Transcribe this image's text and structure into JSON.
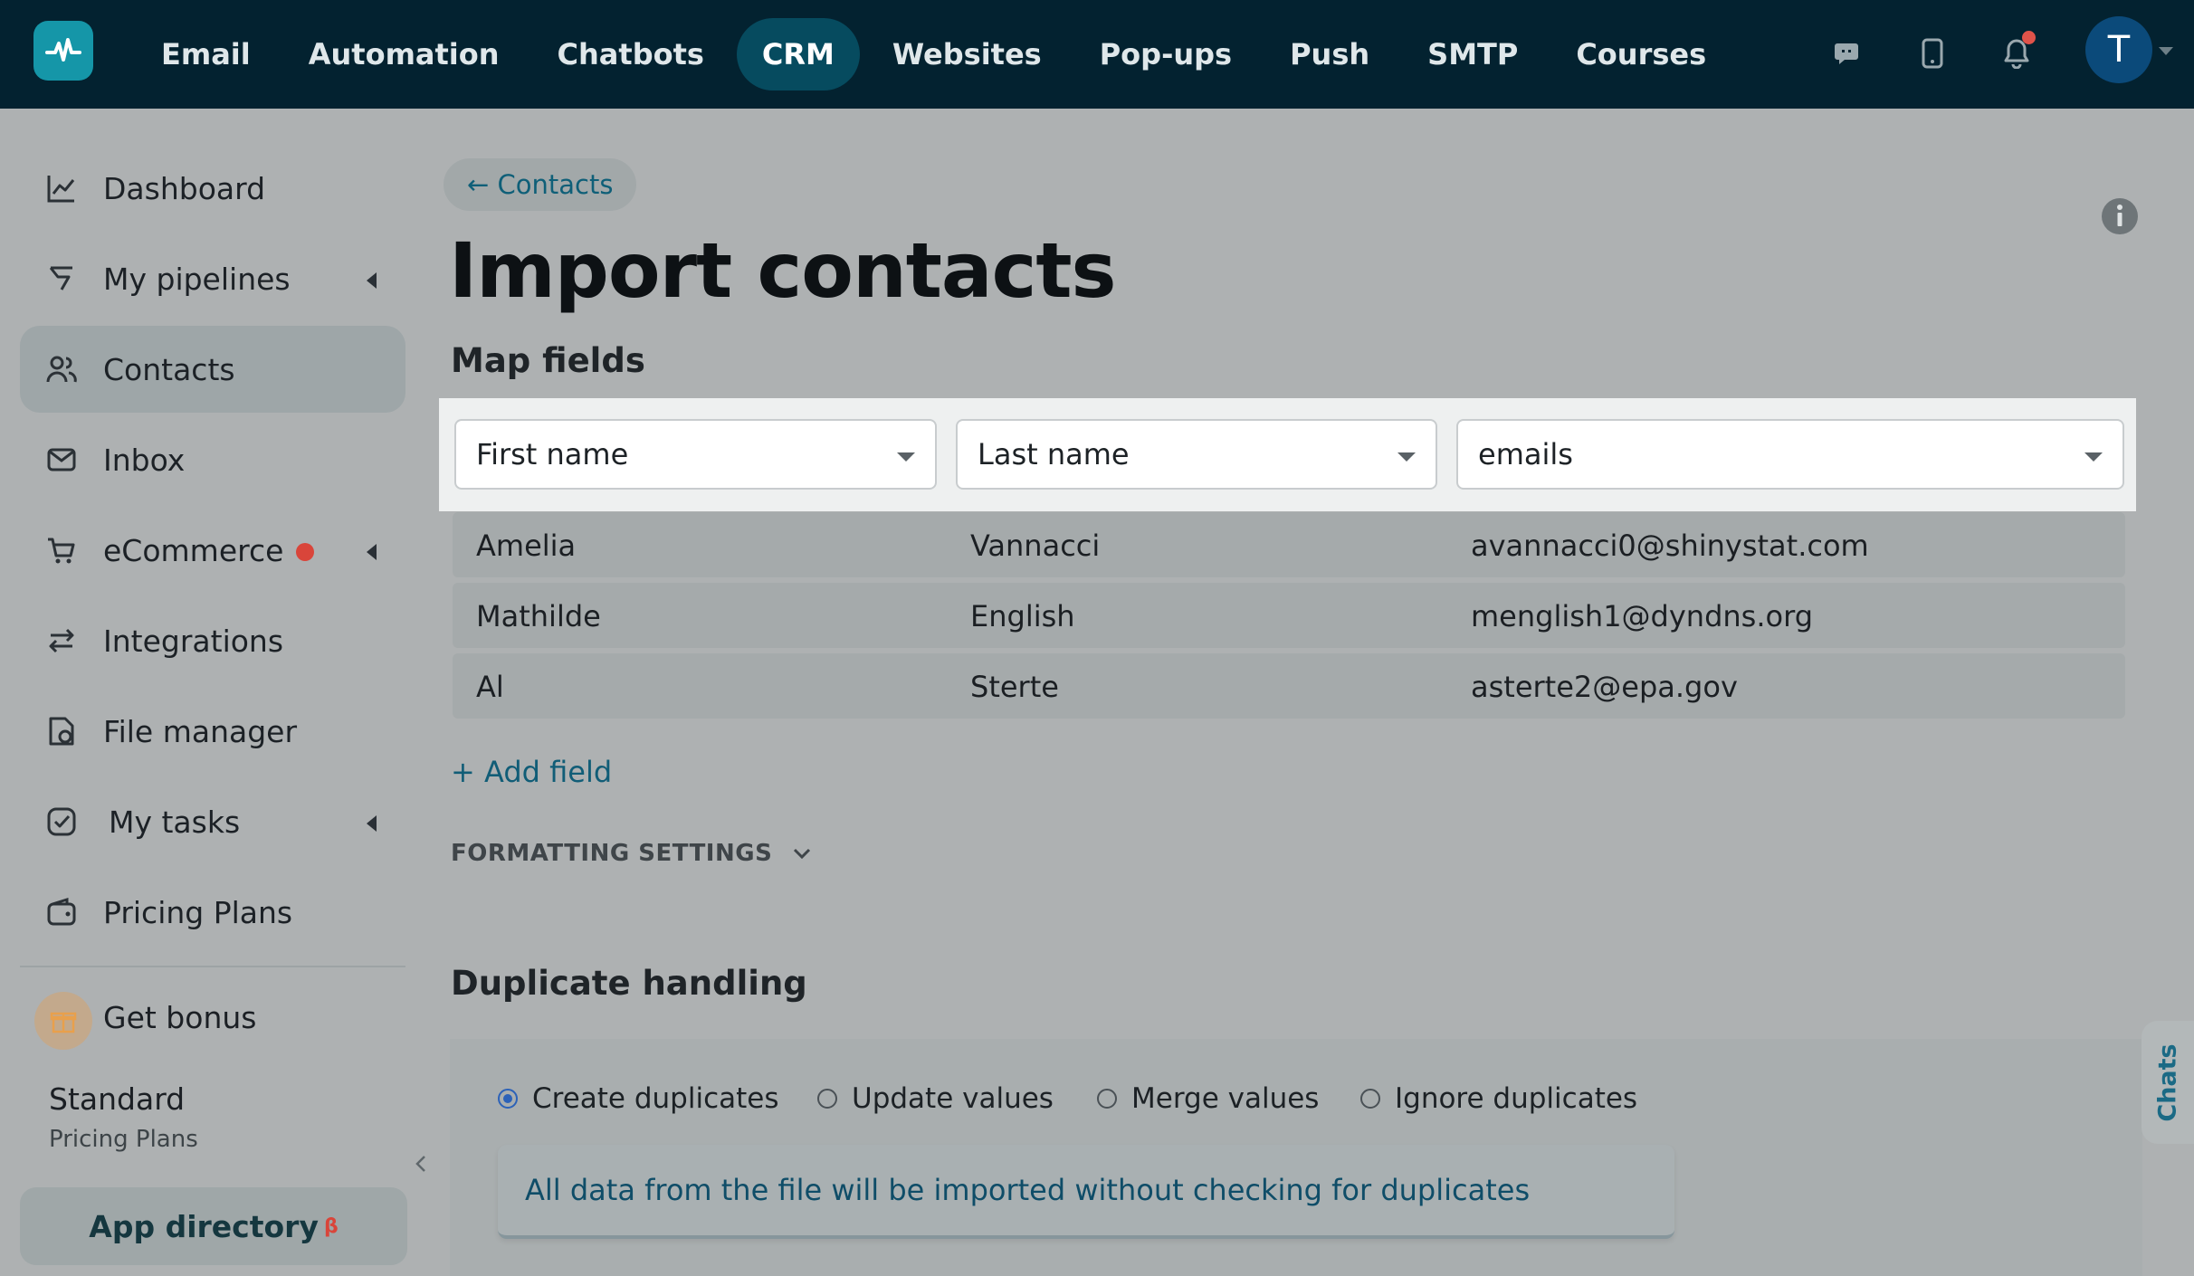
{
  "nav": {
    "items": [
      "Email",
      "Automation",
      "Chatbots",
      "CRM",
      "Websites",
      "Pop-ups",
      "Push",
      "SMTP",
      "Courses"
    ],
    "active": "CRM"
  },
  "user": {
    "initial": "T"
  },
  "sidebar": {
    "items": [
      {
        "label": "Dashboard"
      },
      {
        "label": "My pipelines"
      },
      {
        "label": "Contacts"
      },
      {
        "label": "Inbox"
      },
      {
        "label": "eCommerce"
      },
      {
        "label": "Integrations"
      },
      {
        "label": "File manager"
      },
      {
        "label": "My tasks"
      },
      {
        "label": "Pricing Plans"
      }
    ],
    "bonus": "Get bonus",
    "plan_name": "Standard",
    "plan_sub": "Pricing Plans",
    "app_directory": "App directory",
    "app_directory_badge": "β"
  },
  "page": {
    "back_link": "← Contacts",
    "title": "Import contacts",
    "map_title": "Map fields",
    "field_selects": [
      "First name",
      "Last name",
      "emails"
    ],
    "rows": [
      [
        "Amelia",
        "Vannacci",
        "avannacci0@shinystat.com"
      ],
      [
        "Mathilde",
        "English",
        "menglish1@dyndns.org"
      ],
      [
        "Al",
        "Sterte",
        "asterte2@epa.gov"
      ]
    ],
    "add_field": "+ Add field",
    "formatting": "FORMATTING SETTINGS",
    "dup_title": "Duplicate handling",
    "dup_options": [
      "Create duplicates",
      "Update values",
      "Merge values",
      "Ignore duplicates"
    ],
    "dup_selected": "Create duplicates",
    "dup_note": "All data from the file will be imported without checking for duplicates",
    "chats": "Chats"
  },
  "colors": {
    "topbar": "#032230",
    "accent": "#1596a8",
    "link": "#115d77",
    "radio_checked": "#2c62b8",
    "badge_red": "#d9453a"
  }
}
